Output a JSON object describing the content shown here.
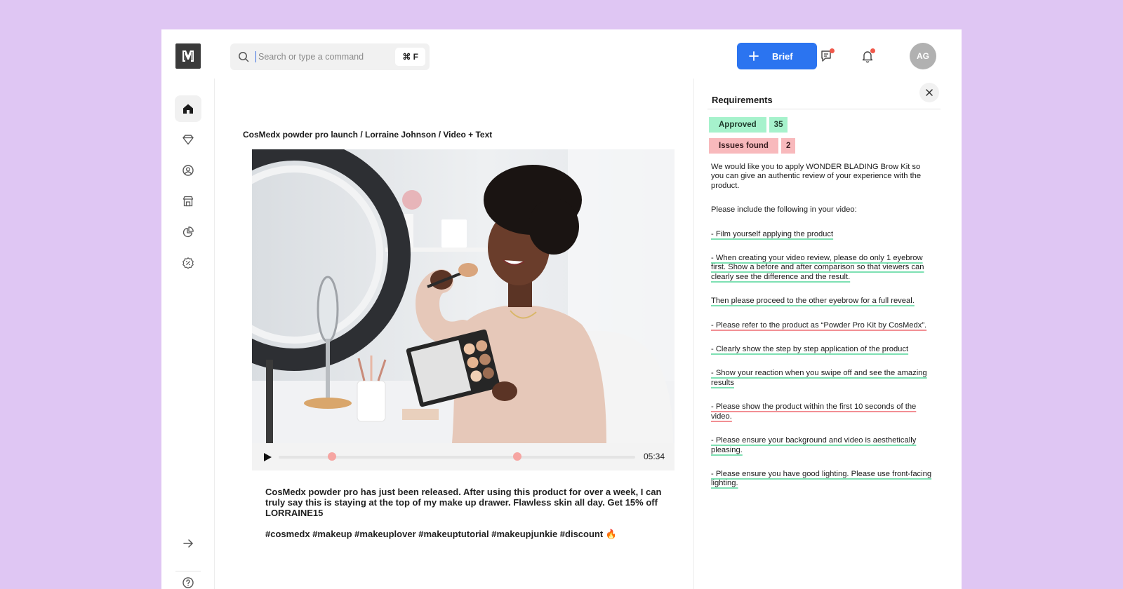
{
  "topbar": {
    "search_placeholder": "Search or type a command",
    "shortcut": "⌘ F",
    "brief_label": "Brief",
    "avatar_initials": "AG"
  },
  "breadcrumb": "CosMedx powder pro launch / Lorraine Johnson / Video + Text",
  "player": {
    "duration": "05:34",
    "markers_fraction": [
      0.15,
      0.67
    ]
  },
  "post": {
    "caption": "CosMedx powder pro has just been released.  After using this product for over a week, I can truly say this is staying at the top of my make up drawer. Flawless skin all day. Get 15% off LORRAINE15",
    "hashtags": "#cosmedx #makeup #makeuplover #makeuptutorial #makeupjunkie #discount 🔥"
  },
  "requirements": {
    "title": "Requirements",
    "approved_label": "Approved",
    "approved_count": "35",
    "issues_label": "Issues found",
    "issues_count": "2",
    "intro": "We would like you to apply WONDER BLADING Brow Kit so you can give an authentic review of your experience with the product.",
    "include": "Please include the following in your video:",
    "items": [
      {
        "text": "- Film yourself applying the product",
        "status": "approved"
      },
      {
        "text": "- When creating your video review, please do only 1 eyebrow first. Show a before and after comparison so that viewers can clearly see the difference and the result.",
        "status": "approved"
      },
      {
        "text": "Then please proceed to the other eyebrow for a full reveal.",
        "status": "approved"
      },
      {
        "text": "- Please refer to the product as “Powder Pro Kit by CosMedx”.",
        "status": "issue"
      },
      {
        "text": "- Clearly show the step by step application of the product",
        "status": "approved"
      },
      {
        "text": "- Show your reaction when you swipe off and see the amazing results",
        "status": "approved"
      },
      {
        "text": "- Please show the product within the first 10 seconds of the video.",
        "status": "issue"
      },
      {
        "text": "- Please ensure your background and video is aesthetically pleasing.",
        "status": "approved"
      },
      {
        "text": "- Please ensure you have good lighting. Please use front-facing lighting.",
        "status": "approved"
      }
    ]
  },
  "colors": {
    "background": "#dfc6f3",
    "accent": "#2b74f0",
    "approved": "#a6f2cc",
    "issue": "#f8b9bc",
    "notification_dot": "#f0584a"
  },
  "icons": {
    "rail": [
      "home-icon",
      "diamond-icon",
      "user-circle-icon",
      "store-icon",
      "pie-chart-icon",
      "discount-badge-icon",
      "arrow-right-icon",
      "help-icon"
    ],
    "topbar": [
      "search-icon",
      "plus-icon",
      "messages-icon",
      "bell-icon",
      "close-icon"
    ]
  }
}
